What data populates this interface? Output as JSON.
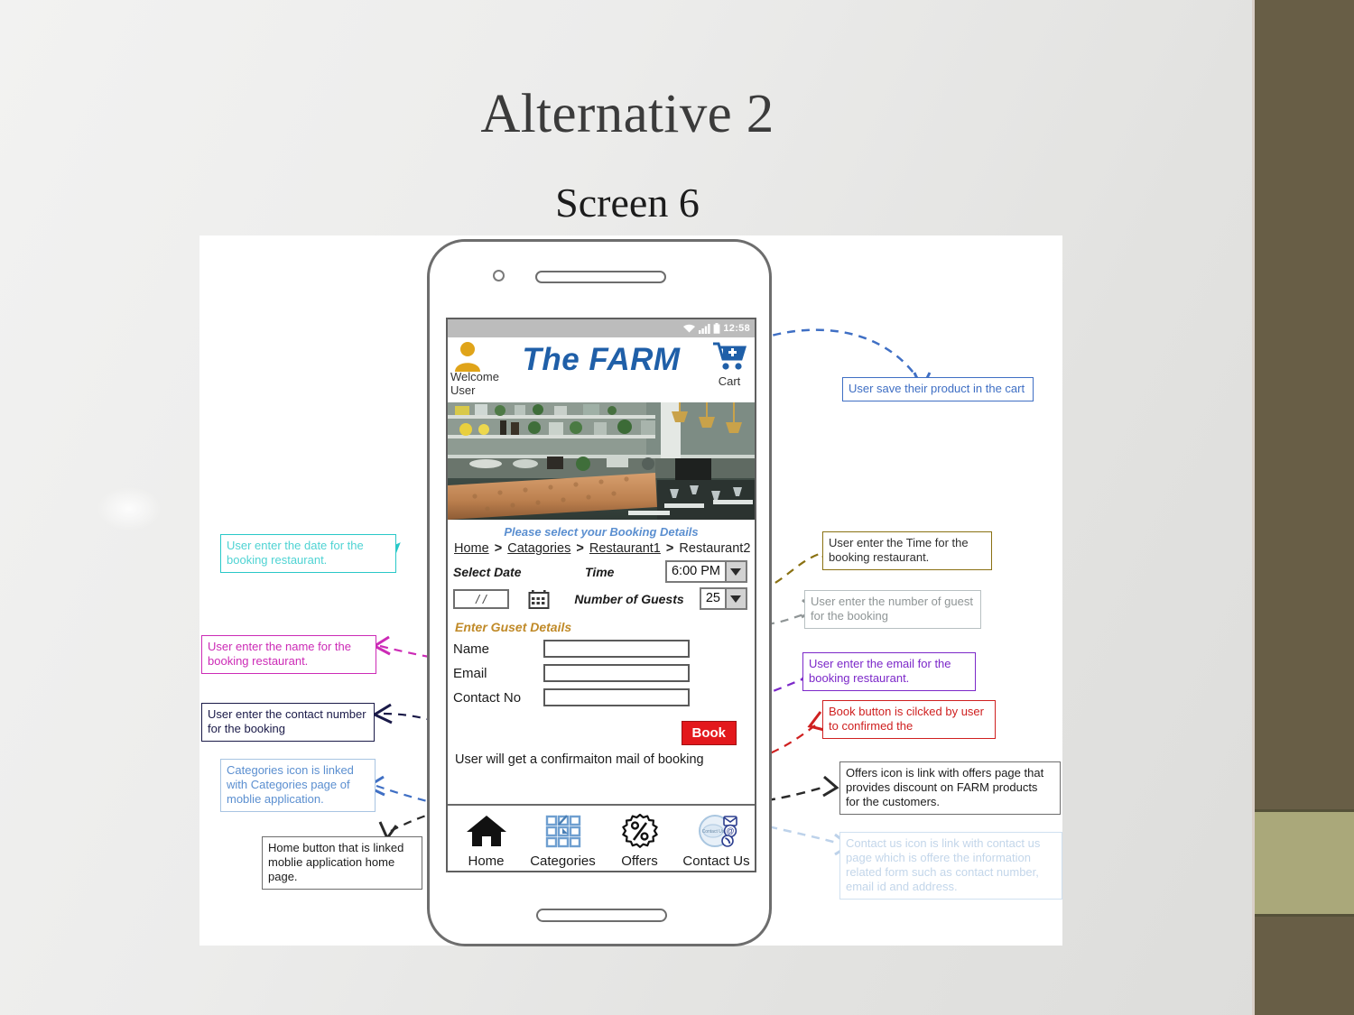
{
  "slide": {
    "title": "Alternative 2",
    "subtitle": "Screen 6"
  },
  "phone": {
    "status_bar": {
      "time": "12:58"
    },
    "app_header": {
      "brand": "The FARM",
      "welcome_line1": "Welcome",
      "welcome_line2": "User",
      "cart_label": "Cart"
    },
    "booking": {
      "heading": "Please select your Booking Details",
      "breadcrumb": [
        {
          "label": "Home",
          "link": true
        },
        {
          "label": "Catagories",
          "link": true
        },
        {
          "label": "Restaurant1",
          "link": true
        },
        {
          "label": "Restaurant2",
          "link": false
        }
      ],
      "breadcrumb_separator": ">",
      "select_date_label": "Select Date",
      "date_value": "/  /",
      "time_label": "Time",
      "time_value": "6:00 PM",
      "guests_label": "Number of Guests",
      "guests_value": "25"
    },
    "guest_details": {
      "heading": "Enter Guset Details",
      "fields": [
        {
          "label": "Name",
          "value": ""
        },
        {
          "label": "Email",
          "value": ""
        },
        {
          "label": "Contact No",
          "value": ""
        }
      ],
      "book_button": "Book",
      "confirmation_note": "User will get a confirmaiton mail of booking"
    },
    "bottom_nav": [
      {
        "label": "Home",
        "icon": "home-icon"
      },
      {
        "label": "Categories",
        "icon": "grid-icon"
      },
      {
        "label": "Offers",
        "icon": "percent-badge-icon"
      },
      {
        "label": "Contact Us",
        "icon": "contact-badge-icon"
      }
    ]
  },
  "annotations": {
    "cart": {
      "text": "User save their product in the cart",
      "color": "#3f6fc4"
    },
    "date": {
      "text": "User enter the date for the booking restaurant.",
      "color": "#29c8c8"
    },
    "time": {
      "text": "User enter the Time for the booking restaurant.",
      "color": "#8a7112"
    },
    "guests": {
      "text": "User enter the number of guest for the booking",
      "color": "#8f9596"
    },
    "name": {
      "text": "User enter the name for the booking restaurant.",
      "color": "#cc2bb6"
    },
    "email": {
      "text": "User enter the email for the booking restaurant.",
      "color": "#7c28c9"
    },
    "contact": {
      "text": "User enter the contact number for the booking",
      "color": "#1a1a48"
    },
    "book": {
      "text": "Book button is cilcked by user to confirmed the",
      "color": "#cf2020"
    },
    "categories": {
      "text": "Categories icon is linked with Categories page of moblie application.",
      "color": "#5b8fd0"
    },
    "home": {
      "text": "Home button that is linked moblie application home page.",
      "color": "#2a2a2a"
    },
    "offers": {
      "text": "Offers icon is link with offers page that  provides discount on FARM products for the customers.",
      "color": "#2a2a2a"
    },
    "contactus": {
      "text": "Contact us icon is link with contact us page which is offere the information related form such as contact number, email id and address.",
      "color": "#bdd2ea"
    }
  },
  "theme": {
    "rail_brown": "#685e46",
    "rail_olive": "#aaa87a",
    "brand_blue": "#1f5fa8",
    "book_red": "#e3181c",
    "guest_gold": "#c08a28"
  }
}
